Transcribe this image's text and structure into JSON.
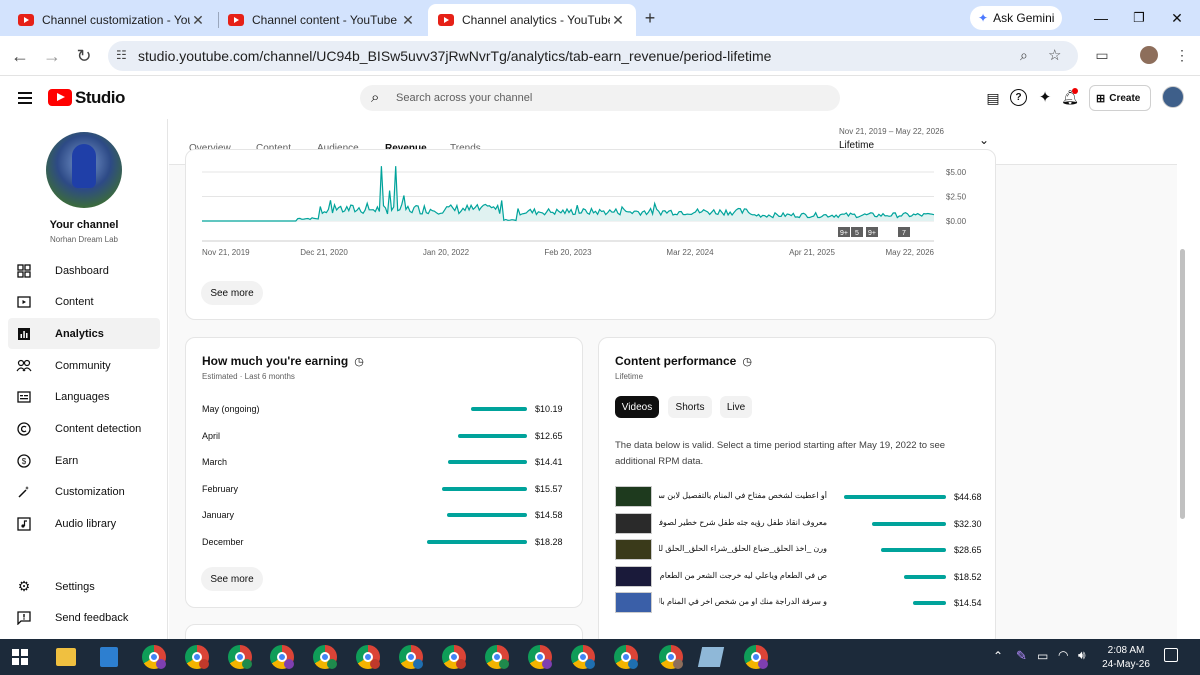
{
  "browser": {
    "tabs": [
      {
        "title": "Channel customization - YouTu"
      },
      {
        "title": "Channel content - YouTube Stu"
      },
      {
        "title": "Channel analytics - YouTube St"
      }
    ],
    "new_tab": "+",
    "gemini_label": "Ask Gemini",
    "url": "studio.youtube.com/channel/UC94b_BISw5uvv37jRwNvrTg/analytics/tab-earn_revenue/period-lifetime"
  },
  "header": {
    "logo_text": "Studio",
    "search_placeholder": "Search across your channel",
    "create_label": "Create"
  },
  "sidebar": {
    "your_channel": "Your channel",
    "channel_name": "Norhan Dream Lab",
    "items": [
      {
        "label": "Dashboard",
        "icon": "dashboard-icon"
      },
      {
        "label": "Content",
        "icon": "content-icon"
      },
      {
        "label": "Analytics",
        "icon": "analytics-icon",
        "selected": true
      },
      {
        "label": "Community",
        "icon": "community-icon"
      },
      {
        "label": "Languages",
        "icon": "languages-icon"
      },
      {
        "label": "Content detection",
        "icon": "copyright-icon"
      },
      {
        "label": "Earn",
        "icon": "dollar-icon"
      },
      {
        "label": "Customization",
        "icon": "wand-icon"
      },
      {
        "label": "Audio library",
        "icon": "audio-icon"
      }
    ],
    "settings": "Settings",
    "feedback": "Send feedback"
  },
  "tabs": {
    "items": [
      "Overview",
      "Content",
      "Audience",
      "Revenue",
      "Trends"
    ],
    "active": "Revenue",
    "date_range": "Nov 21, 2019 – May 22, 2026",
    "period": "Lifetime"
  },
  "revenue_chart": {
    "chart_data": {
      "type": "area",
      "y_ticks": [
        "$5.00",
        "$2.50",
        "$0.00"
      ],
      "x_ticks": [
        "Nov 21, 2019",
        "Dec 21, 2020",
        "Jan 20, 2022",
        "Feb 20, 2023",
        "Mar 22, 2024",
        "Apr 21, 2025",
        "May 22, 2026"
      ],
      "ylim": [
        0,
        5.5
      ],
      "series_color": "#00a39b",
      "markers": [
        "9+",
        "5",
        "9+",
        "7"
      ]
    },
    "see_more": "See more"
  },
  "earning": {
    "title": "How much you're earning",
    "subtitle": "Estimated · Last 6 months",
    "rows": [
      {
        "month": "May (ongoing)",
        "value": "$10.19",
        "amount": 10.19
      },
      {
        "month": "April",
        "value": "$12.65",
        "amount": 12.65
      },
      {
        "month": "March",
        "value": "$14.41",
        "amount": 14.41
      },
      {
        "month": "February",
        "value": "$15.57",
        "amount": 15.57
      },
      {
        "month": "January",
        "value": "$14.58",
        "amount": 14.58
      },
      {
        "month": "December",
        "value": "$18.28",
        "amount": 18.28
      }
    ],
    "see_more": "See more"
  },
  "performance": {
    "title": "Content performance",
    "subtitle": "Lifetime",
    "filters": [
      "Videos",
      "Shorts",
      "Live"
    ],
    "active_filter": "Videos",
    "note": "The data below is valid. Select a time period starting after May 19, 2022 to see additional RPM data.",
    "rows": [
      {
        "title": "أو اعطيت لشخص مفتاح في المنام بالتفصيل لابن سيرين ...",
        "value": "$44.68",
        "amount": 44.68
      },
      {
        "title": "معروف انقاذ طفل رؤيه جثه طفل شرح خطير لصوفيا داد ...",
        "value": "$32.30",
        "amount": 32.3
      },
      {
        "title": "ورن _اخذ الحلق_ضياع الحلق_شراء الحلق_الحلق للحامل ...",
        "value": "$28.65",
        "amount": 28.65
      },
      {
        "title": "ص في الطعام وياعلي ليه خرجت الشعر من الطعام او اكلته ...",
        "value": "$18.52",
        "amount": 18.52
      },
      {
        "title": "و سرقة الدراجة منك او من شخص اخر في المنام بالتفصيل ...",
        "value": "$14.54",
        "amount": 14.54
      }
    ]
  },
  "taskbar": {
    "time": "2:08 AM",
    "date": "24-May-26"
  }
}
